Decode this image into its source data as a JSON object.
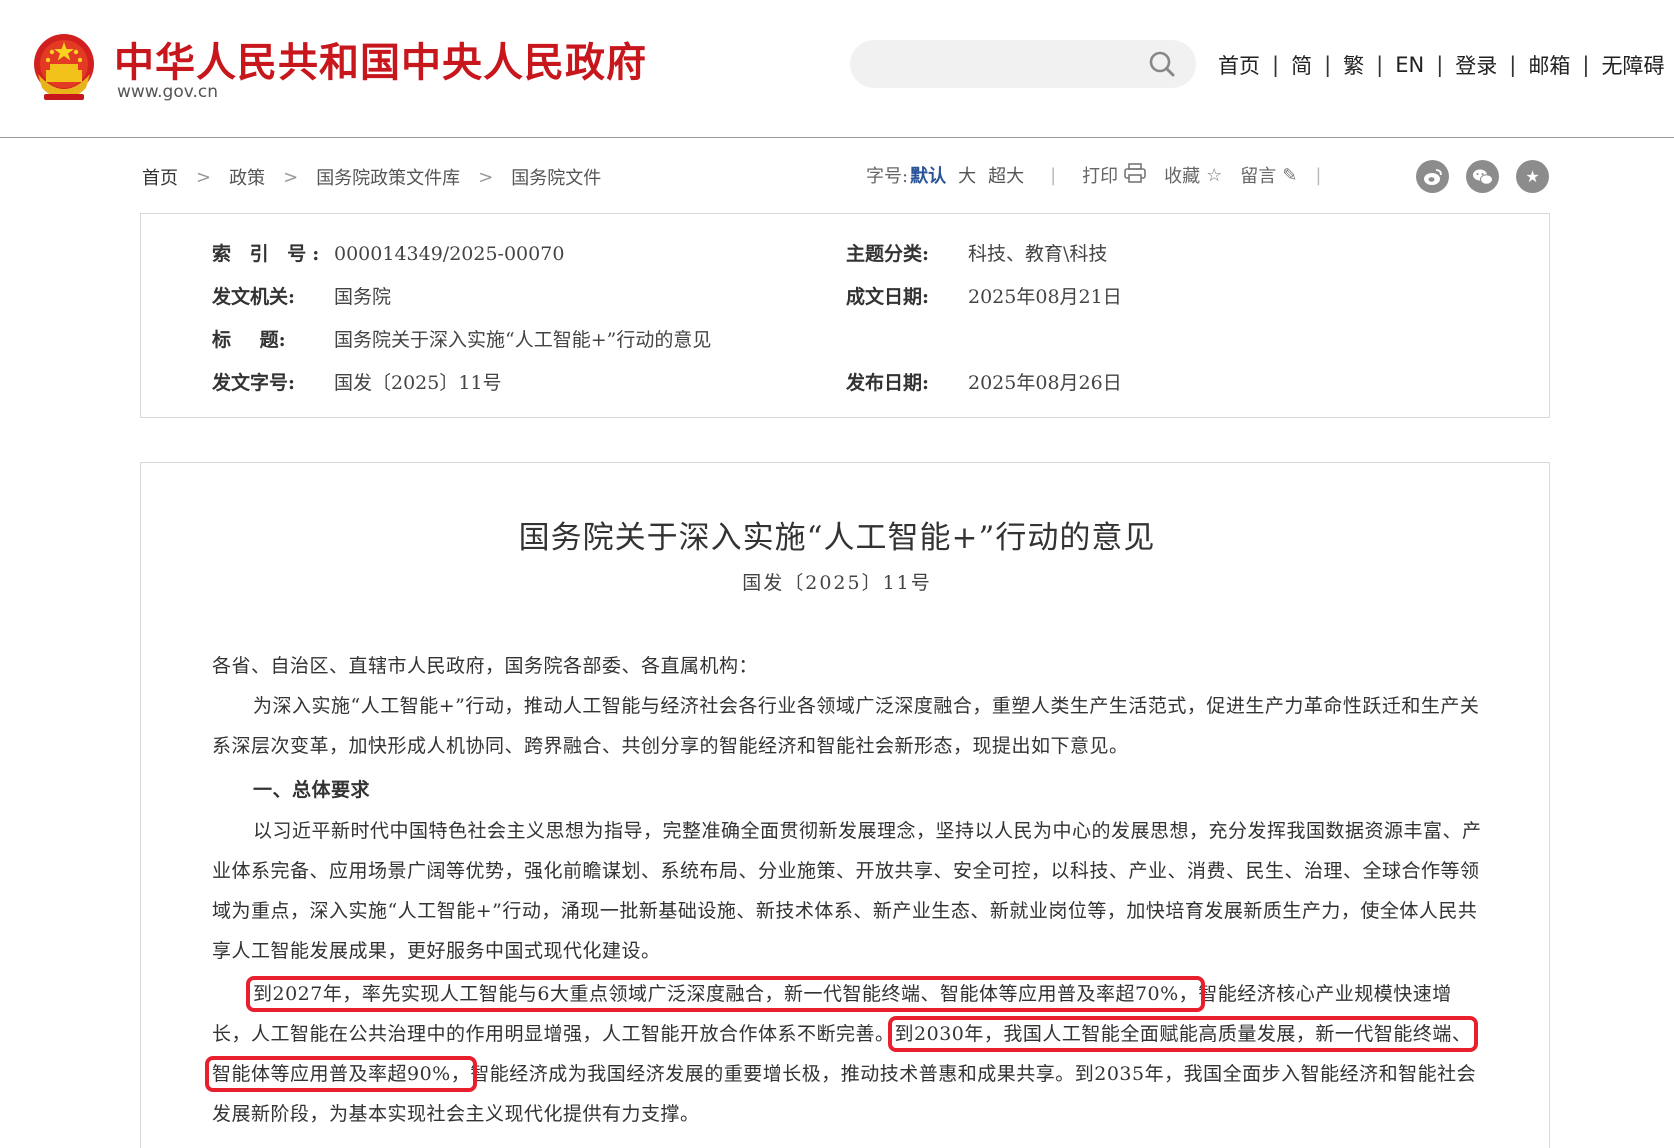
{
  "header": {
    "site_title": "中华人民共和国中央人民政府",
    "site_url": "www.gov.cn",
    "search_placeholder": "",
    "nav": [
      "首页",
      "简",
      "繁",
      "EN",
      "登录",
      "邮箱",
      "无障碍"
    ],
    "nav_separator": "|"
  },
  "breadcrumb": {
    "items": [
      "首页",
      "政策",
      "国务院政策文件库",
      "国务院文件"
    ],
    "arrow": ">"
  },
  "tools": {
    "font_size_label": "字号:",
    "font_default": "默认",
    "font_large": "大",
    "font_xlarge": "超大",
    "print": "打印",
    "favorite": "收藏",
    "comment": "留言"
  },
  "share_icons": [
    "weibo-icon",
    "wechat-icon",
    "star-icon"
  ],
  "info": {
    "index_label": "索 引 号:",
    "index_value": "000014349/2025-00070",
    "topic_label": "主题分类:",
    "topic_value": "科技、教育\\科技",
    "issuer_label": "发文机关:",
    "issuer_value": "国务院",
    "written_label": "成文日期:",
    "written_value": "2025年08月21日",
    "title_label": "标 题:",
    "title_value": "国务院关于深入实施“人工智能+”行动的意见",
    "docno_label": "发文字号:",
    "docno_value": "国发〔2025〕11号",
    "published_label": "发布日期:",
    "published_value": "2025年08月26日"
  },
  "article": {
    "title": "国务院关于深入实施“人工智能+”行动的意见",
    "doc_number": "国发〔2025〕11号",
    "salutation": "各省、自治区、直辖市人民政府，国务院各部委、各直属机构：",
    "p1": "为深入实施“人工智能+”行动，推动人工智能与经济社会各行业各领域广泛深度融合，重塑人类生产生活范式，促进生产力革命性跃迁和生产关系深层次变革，加快形成人机协同、跨界融合、共创分享的智能经济和智能社会新形态，现提出如下意见。",
    "heading1": "一、总体要求",
    "p2": "以习近平新时代中国特色社会主义思想为指导，完整准确全面贯彻新发展理念，坚持以人民为中心的发展思想，充分发挥我国数据资源丰富、产业体系完备、应用场景广阔等优势，强化前瞻谋划、系统布局、分业施策、开放共享、安全可控，以科技、产业、消费、民生、治理、全球合作等领域为重点，深入实施“人工智能+”行动，涌现一批新基础设施、新技术体系、新产业生态、新就业岗位等，加快培育发展新质生产力，使全体人民共享人工智能发展成果，更好服务中国式现代化建设。",
    "p3_hl1": "到2027年，率先实现人工智能与6大重点领域广泛深度融合，新一代智能终端、智能体等应用普及率超70%，",
    "p3_mid1": "智能经济核心产业规模快速增长，人工智能在公共治理中的作用明显增强，人工智能开放合作体系不断完善。",
    "p3_hl2": "到2030年，我国人工智能全面赋能高质量发展，新一代智能终端、智能体等应用普及率超90%，",
    "p3_end": "智能经济成为我国经济发展的重要增长极，推动技术普惠和成果共享。到2035年，我国全面步入智能经济和智能社会发展新阶段，为基本实现社会主义现代化提供有力支撑。"
  },
  "colors": {
    "brand_red": "#c8161d",
    "highlight_red": "#e8202d",
    "link_blue": "#2a5599"
  }
}
